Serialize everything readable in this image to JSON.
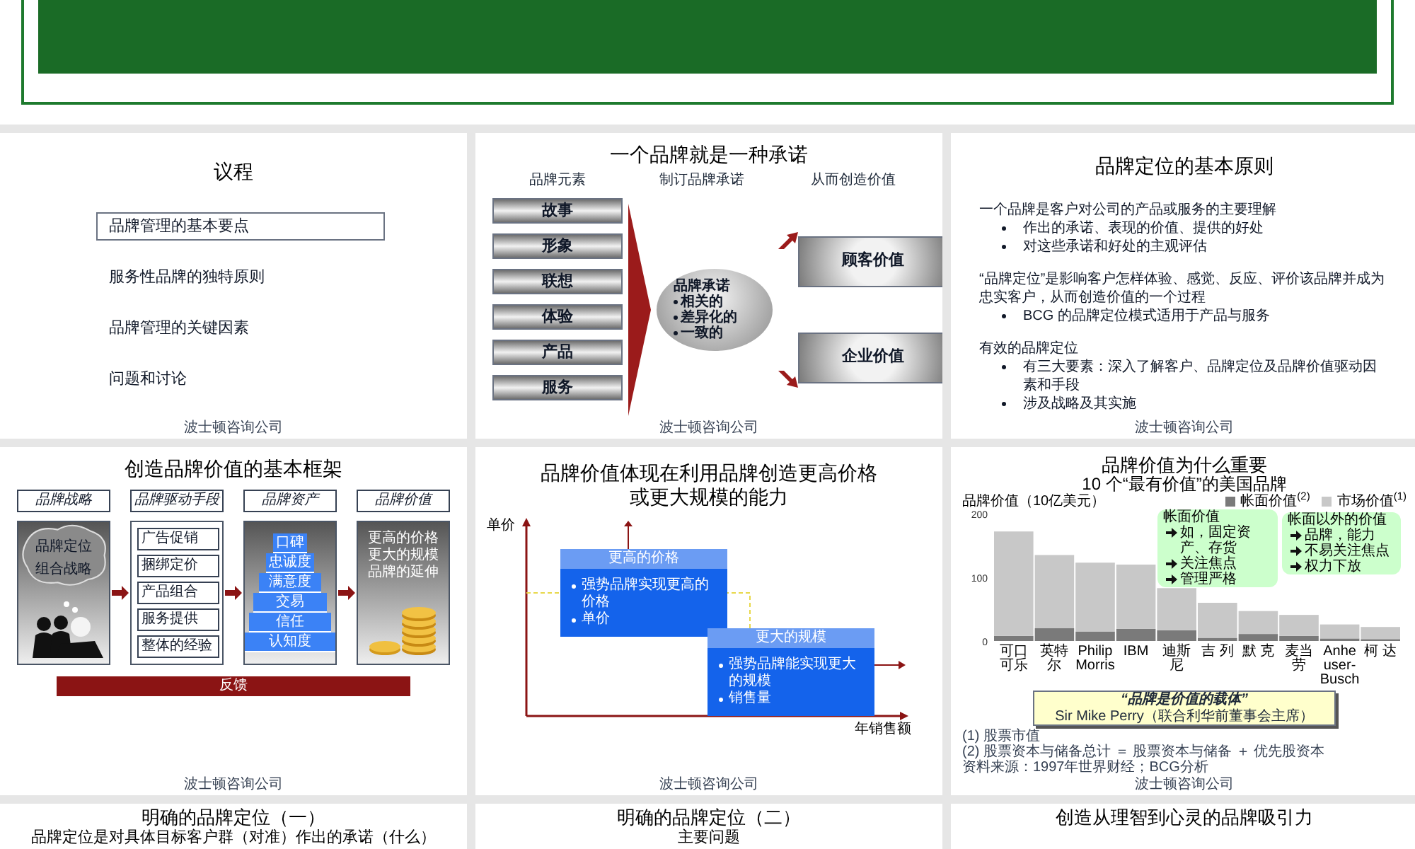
{
  "slides": [
    {
      "kind": "agenda",
      "title": "议程",
      "items": [
        {
          "label": "品牌管理的基本要点",
          "selected": true
        },
        {
          "label": "服务性品牌的独特原则",
          "selected": false
        },
        {
          "label": "品牌管理的关键因素",
          "selected": false
        },
        {
          "label": "问题和讨论",
          "selected": false
        }
      ],
      "footer": "波士顿咨询公司"
    },
    {
      "kind": "promise",
      "title": "一个品牌就是一种承诺",
      "headers": [
        "品牌元素",
        "制订品牌承诺",
        "从而创造价值"
      ],
      "elements": [
        "故事",
        "形象",
        "联想",
        "体验",
        "产品",
        "服务"
      ],
      "promise": {
        "title": "品牌承诺",
        "points": [
          "相关的",
          "差异化的",
          "一致的"
        ]
      },
      "values": [
        "顾客价值",
        "企业价值"
      ],
      "footer": "波士顿咨询公司"
    },
    {
      "kind": "principles",
      "title": "品牌定位的基本原则",
      "blocks": [
        {
          "text": "一个品牌是客户对公司的产品或服务的主要理解",
          "bullets": [
            "作出的承诺、表现的价值、提供的好处",
            "对这些承诺和好处的主观评估"
          ]
        },
        {
          "text": "“品牌定位”是影响客户怎样体验、感觉、反应、评价该品牌并成为忠实客户，从而创造价值的一个过程",
          "bullets": [
            "BCG 的品牌定位模式适用于产品与服务"
          ]
        },
        {
          "text": "有效的品牌定位",
          "bullets": [
            "有三大要素：深入了解客户、品牌定位及品牌价值驱动因素和手段",
            "涉及战略及其实施"
          ]
        }
      ],
      "footer": "波士顿咨询公司"
    },
    {
      "kind": "framework",
      "title": "创造品牌价值的基本框架",
      "headers": [
        "品牌战略",
        "品牌驱动手段",
        "品牌资产",
        "品牌价值"
      ],
      "strategy": [
        "品牌定位",
        "组合战略"
      ],
      "drivers": [
        "广告促销",
        "捆绑定价",
        "产品组合",
        "服务提供",
        "整体的经验"
      ],
      "pyramid": [
        "口碑",
        "忠诚度",
        "满意度",
        "交易",
        "信任",
        "认知度"
      ],
      "outcomes": [
        "更高的价格",
        "更大的规模",
        "品牌的延伸"
      ],
      "feedback": "反馈",
      "footer": "波士顿咨询公司"
    },
    {
      "kind": "price-scale",
      "title_lines": [
        "品牌价值体现在利用品牌创造更高价格",
        "或更大规模的能力"
      ],
      "y_axis": "单价",
      "x_axis": "年销售额",
      "boxes": [
        {
          "heading": "更高的价格",
          "bullets": [
            "强势品牌实现更高的价格",
            "单价"
          ]
        },
        {
          "heading": "更大的规模",
          "bullets": [
            "强势品牌能实现更大的规模",
            "销售量"
          ]
        }
      ],
      "footer": "波士顿咨询公司"
    },
    {
      "kind": "brand-chart",
      "title": "品牌价值为什么重要",
      "subtitle": "10 个“最有价值”的美国品牌",
      "chart_data": {
        "type": "bar",
        "ylabel": "品牌价值（10亿美元）",
        "categories": [
          "可口可乐",
          "英特尔",
          "Philip Morris",
          "IBM",
          "迪斯尼",
          "吉 列",
          "默 克",
          "麦当劳",
          "Anheuser-Busch",
          "柯 达"
        ],
        "series": [
          {
            "name": "帐面价值$^{(2)}$",
            "color": "#7a7a7a",
            "values": [
              8,
              20,
              15,
              19,
              17,
              5,
              11,
              8,
              4,
              3
            ]
          },
          {
            "name": "市场价值$^{(1)}$",
            "color": "#c8c8c8",
            "values": [
              164,
              115,
              108,
              101,
              66,
              55,
              36,
              33,
              22,
              19
            ]
          }
        ],
        "stacked": true,
        "legend": "upper right",
        "ylim": [
          0,
          200
        ],
        "yticks": [
          0,
          100,
          200
        ]
      },
      "callouts": [
        {
          "title": "帐面价值",
          "points": [
            "如，固定资产、存货",
            "关注焦点",
            "管理严格"
          ]
        },
        {
          "title": "帐面以外的价值",
          "points": [
            "品牌，能力",
            "不易关注焦点",
            "权力下放"
          ]
        }
      ],
      "quote": "“品牌是价值的载体”",
      "attribution": "Sir Mike Perry（联合利华前董事会主席）",
      "notes": [
        "(1) 股票市值",
        "(2) 股票资本与储备总计 ＝ 股票资本与储备 ＋ 优先股资本",
        "资料来源：1997年世界财经；BCG分析"
      ],
      "footer": "波士顿咨询公司"
    },
    {
      "kind": "partial",
      "title": "明确的品牌定位（一）",
      "subtitle": "品牌定位是对具体目标客户群（对准）作出的承诺（什么）"
    },
    {
      "kind": "partial",
      "title": "明确的品牌定位（二）",
      "subtitle": "主要问题"
    },
    {
      "kind": "partial",
      "title": "创造从理智到心灵的品牌吸引力"
    }
  ]
}
